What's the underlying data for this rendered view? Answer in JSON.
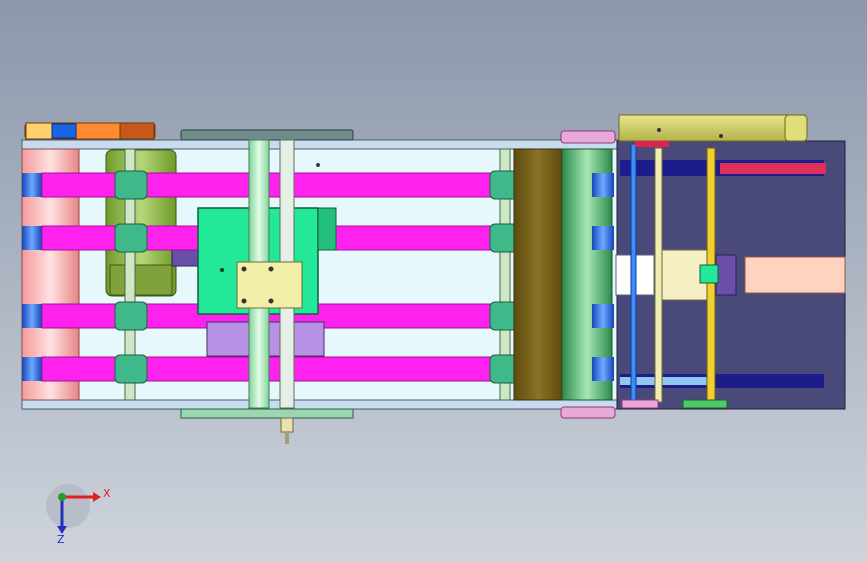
{
  "viewport": {
    "background_top": "#8b98ab",
    "background_bottom": "#cfd4dc"
  },
  "triad": {
    "x_label": "X",
    "z_label": "Z",
    "x_color": "#e02020",
    "z_color": "#2030c0",
    "y_color": "#20a020"
  },
  "colors": {
    "frame_bg": "#e6f8fb",
    "belt": "#ff22ee",
    "belt_light": "#ffb8f0",
    "roller_green": "#3fb88a",
    "rail_green": "#9fe0b6",
    "plate_green": "#22e898",
    "plate_yellow": "#f2f0a8",
    "olive": "#7a6418",
    "dark_panel": "#4a4a7a",
    "navy_bar": "#1c1c8a",
    "salmon": "#ffd3bf",
    "blue_cap": "#1c64e6",
    "pink_roller": "#f7b5b5",
    "khaki": "#d6d46a",
    "orange": "#ff7a20",
    "purple": "#b890e6"
  }
}
